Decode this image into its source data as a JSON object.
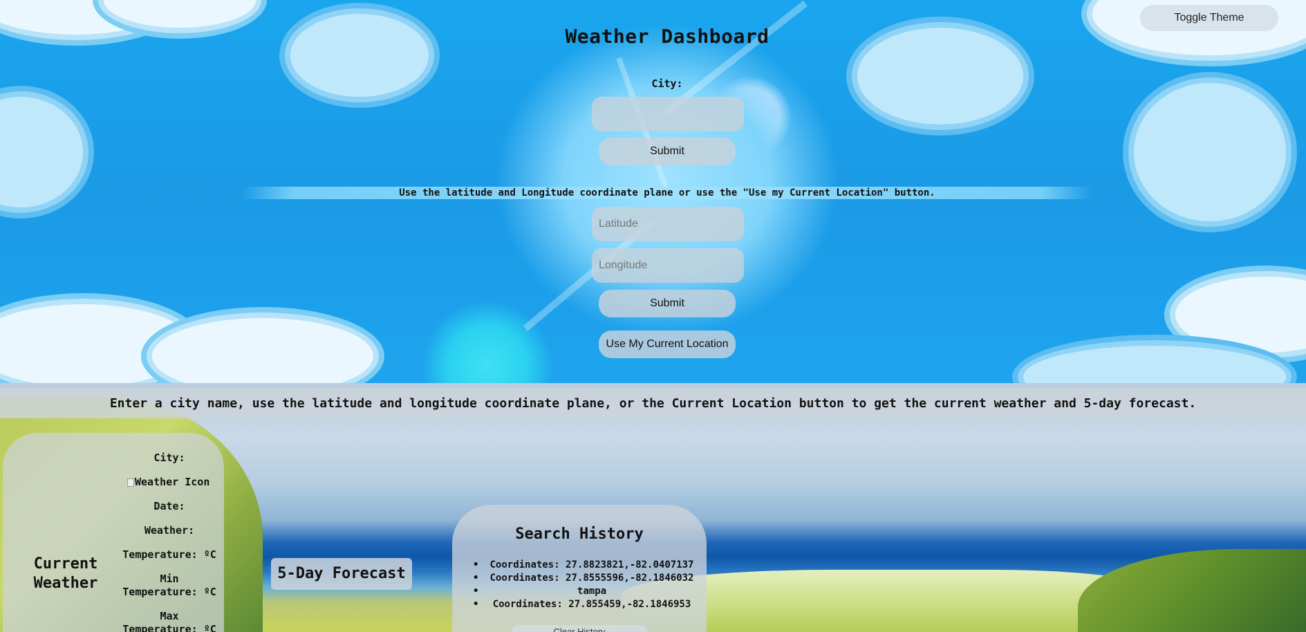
{
  "header": {
    "title": "Weather Dashboard",
    "toggle_theme_label": "Toggle Theme"
  },
  "city_search": {
    "label": "City:",
    "input_value": "",
    "submit_label": "Submit"
  },
  "coordinate_search": {
    "instructions": "Use the latitude and Longitude coordinate plane or use the \"Use my Current Location\" button.",
    "latitude_placeholder": "Latitude",
    "longitude_placeholder": "Longitude",
    "submit_label": "Submit",
    "current_location_label": "Use My Current Location"
  },
  "info_banner": "Enter a city name, use the latitude and longitude coordinate plane, or the Current Location button to get the current weather and 5-day forecast.",
  "current_weather": {
    "heading": "Current Weather",
    "city_label": "City:",
    "icon_alt": "Weather Icon",
    "date_label": "Date:",
    "weather_label": "Weather:",
    "temperature_label": "Temperature: ºC",
    "min_temperature_label": "Min Temperature: ºC",
    "max_temperature_label": "Max Temperature: ºC"
  },
  "forecast": {
    "heading": "5-Day Forecast"
  },
  "search_history": {
    "heading": "Search History",
    "items": [
      "Coordinates: 27.8823821,-82.0407137",
      "Coordinates: 27.8555596,-82.1846032",
      "tampa",
      "Coordinates: 27.855459,-82.1846953"
    ],
    "clear_label": "Clear History"
  },
  "colors": {
    "sky_blue": "#1b9ae6",
    "pill_gray": "#c8d2da",
    "text_dark": "#111111"
  }
}
